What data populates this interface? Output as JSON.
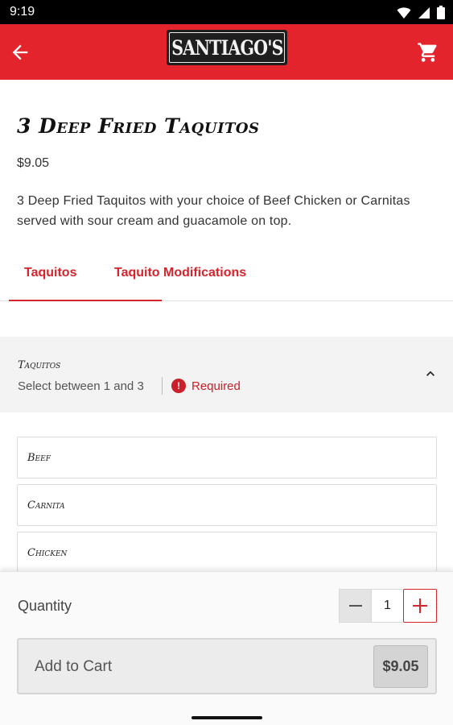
{
  "status_bar": {
    "time": "9:19"
  },
  "header": {
    "logo_text": "SANTIAGO'S",
    "back_icon": "arrow-left-icon",
    "cart_icon": "shopping-cart-icon",
    "brand_color": "#e4242c"
  },
  "item": {
    "title": "3 Deep Fried Taquitos",
    "price": "$9.05",
    "description": "3 Deep Fried Taquitos with your choice of Beef Chicken or Carnitas served with sour cream and guacamole on top."
  },
  "tabs": [
    {
      "label": "Taquitos",
      "active": true
    },
    {
      "label": "Taquito Modifications",
      "active": false
    }
  ],
  "modifier": {
    "title": "Taquitos",
    "subtitle": "Select between 1 and 3",
    "required_label": "Required",
    "required_icon": "exclamation-circle-icon",
    "chevron_icon": "chevron-up-icon",
    "options": [
      "Beef",
      "Carnita",
      "Chicken"
    ]
  },
  "quantity": {
    "label": "Quantity",
    "value": "1"
  },
  "add_to_cart": {
    "label": "Add to Cart",
    "price": "$9.05"
  }
}
